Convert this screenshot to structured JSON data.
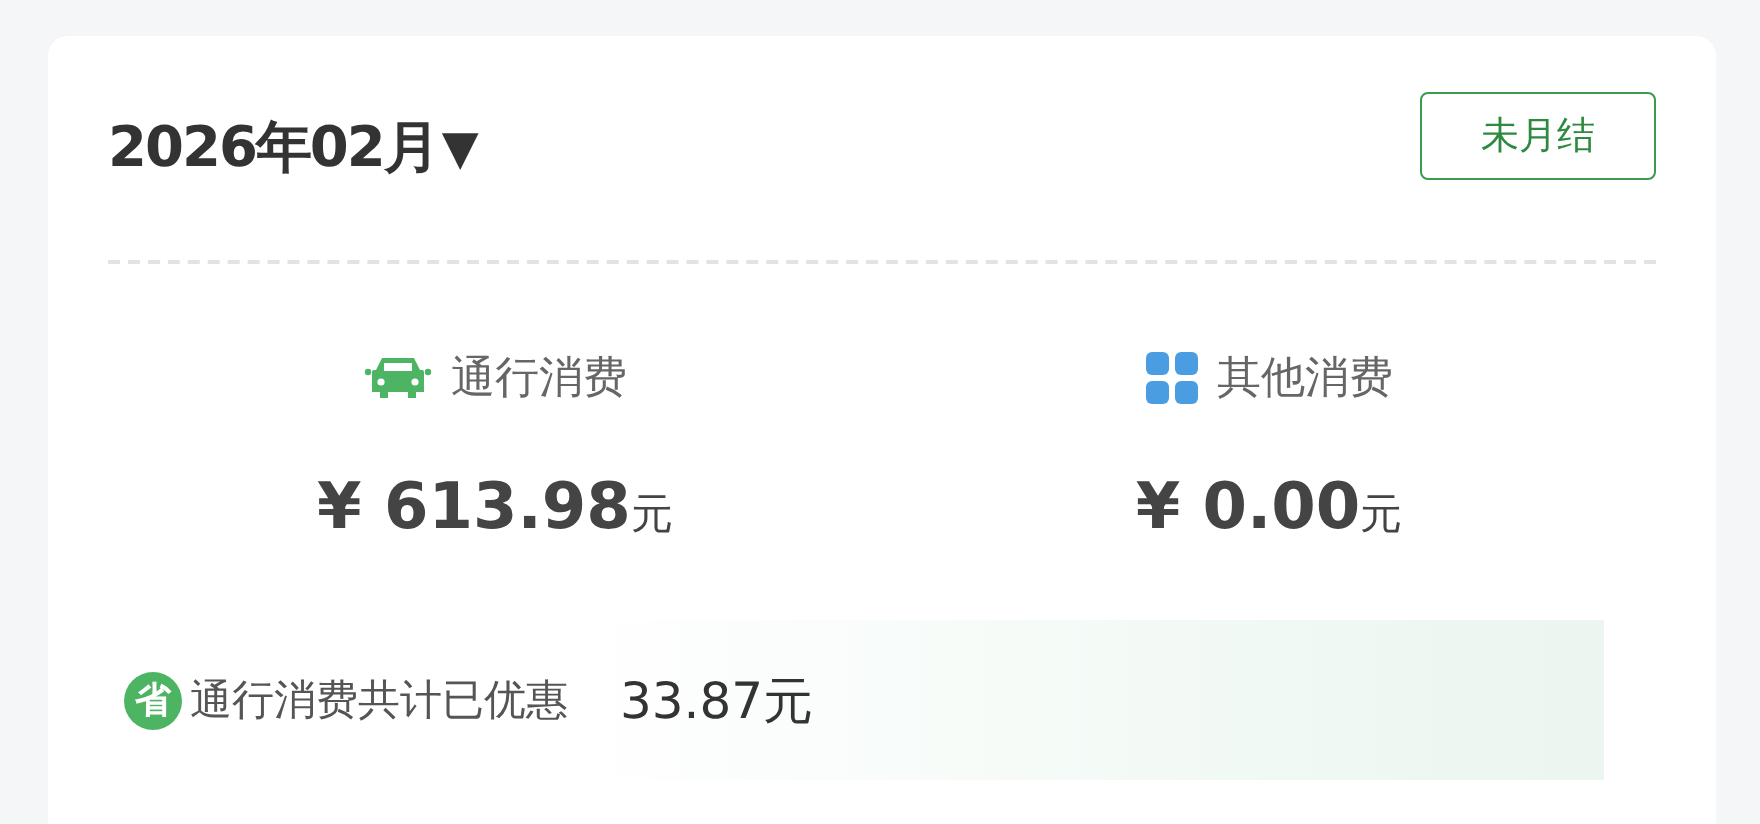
{
  "header": {
    "month": "2026年02月",
    "caret": "▼",
    "status": "未月结"
  },
  "categories": [
    {
      "kind": "toll",
      "label": "通行消费",
      "amount": "¥ 613.98",
      "unit": "元"
    },
    {
      "kind": "other",
      "label": "其他消费",
      "amount": "¥ 0.00",
      "unit": "元"
    }
  ],
  "savings": {
    "badge": "省",
    "label": "通行消费共计已优惠",
    "value": "33.87元"
  }
}
